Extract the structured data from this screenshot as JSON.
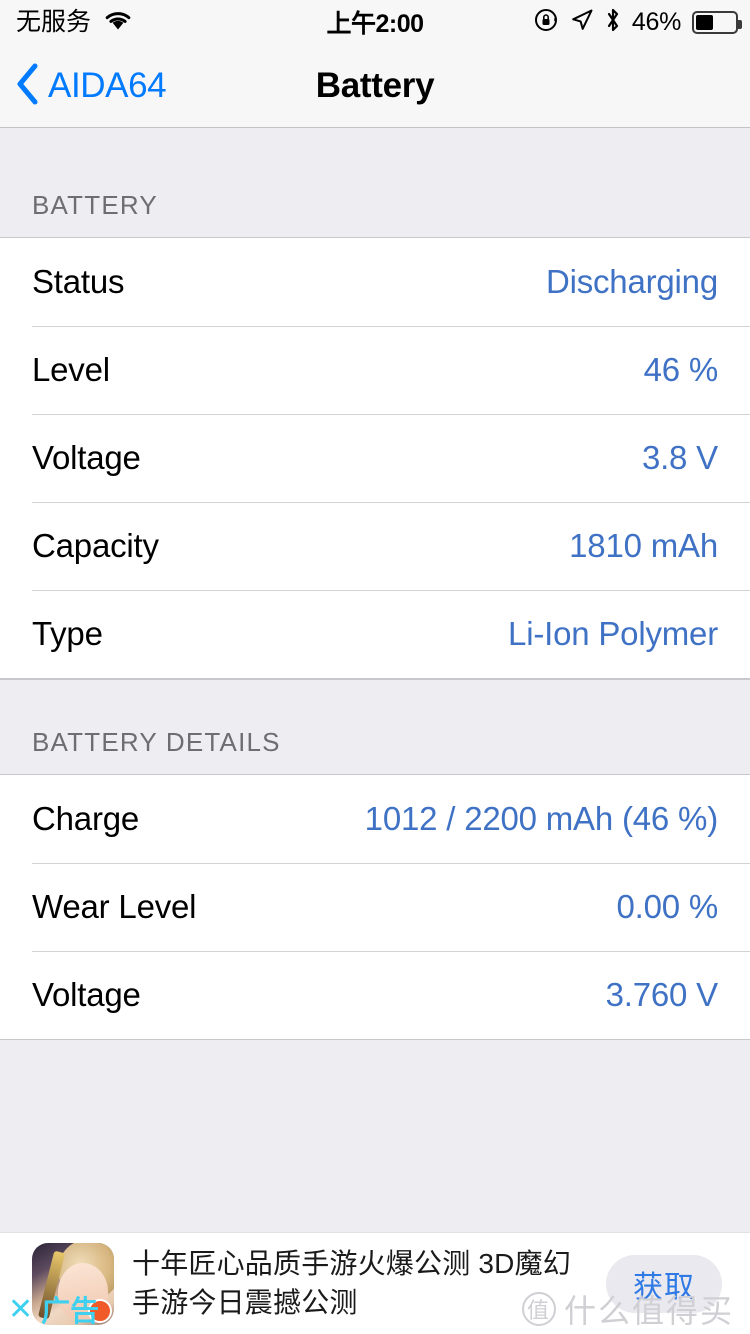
{
  "status_bar": {
    "carrier": "无服务",
    "wifi_icon": "wifi-icon",
    "time": "上午2:00",
    "rotation_lock_icon": "rotation-lock-icon",
    "location_icon": "location-arrow-icon",
    "bluetooth_icon": "bluetooth-icon",
    "battery_percent": "46%",
    "battery_fill_percent": 46
  },
  "nav_bar": {
    "back_icon": "chevron-left-icon",
    "back_label": "AIDA64",
    "title": "Battery"
  },
  "sections": [
    {
      "header": "BATTERY",
      "rows": [
        {
          "label": "Status",
          "value": "Discharging"
        },
        {
          "label": "Level",
          "value": "46 %"
        },
        {
          "label": "Voltage",
          "value": "3.8 V"
        },
        {
          "label": "Capacity",
          "value": "1810 mAh"
        },
        {
          "label": "Type",
          "value": "Li-Ion Polymer"
        }
      ]
    },
    {
      "header": "BATTERY DETAILS",
      "rows": [
        {
          "label": "Charge",
          "value": "1012 / 2200 mAh (46 %)"
        },
        {
          "label": "Wear Level",
          "value": "0.00 %"
        },
        {
          "label": "Voltage",
          "value": "3.760 V"
        }
      ]
    }
  ],
  "ad": {
    "thumbnail_icon": "game-app-icon",
    "text": "十年匠心品质手游火爆公测 3D魔幻手游今日震撼公测",
    "cta_label": "获取",
    "close_x": "✕",
    "close_label": "广告",
    "watermark_mark": "值",
    "watermark_text": "什么值得买"
  },
  "colors": {
    "value_blue": "#3f72c4",
    "tint_blue": "#007aff",
    "section_gray": "#eeeef2",
    "header_text": "#6d6d72",
    "separator": "#d3d3d6",
    "ad_cta_blue": "#2f7ae5",
    "ad_close_cyan": "#3fd0f0"
  }
}
